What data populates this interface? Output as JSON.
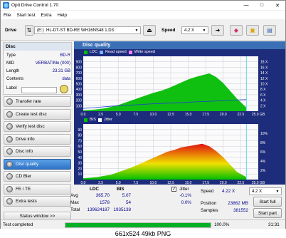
{
  "window": {
    "title": "Opti Drive Control 1.70",
    "min": "—",
    "max": "□",
    "close": "✕"
  },
  "menu": [
    "File",
    "Start test",
    "Extra",
    "Help"
  ],
  "drivebar": {
    "drive_label": "Drive",
    "drive_letter": "(E:)",
    "drive_name": "HL-DT-ST BD-RE  WH16NS48 1.D3",
    "speed_label": "Speed",
    "speed_value": "4.2 X"
  },
  "disc": {
    "header": "Disc",
    "rows": [
      {
        "k": "Type",
        "v": "BD-R"
      },
      {
        "k": "MID",
        "v": "VERBATIMe (000)"
      },
      {
        "k": "Length",
        "v": "23.31 GB"
      },
      {
        "k": "Contents",
        "v": "data"
      }
    ],
    "label_key": "Label"
  },
  "nav": [
    {
      "label": "Transfer rate",
      "active": false
    },
    {
      "label": "Create test disc",
      "active": false
    },
    {
      "label": "Verify test disc",
      "active": false
    },
    {
      "label": "Drive info",
      "active": false
    },
    {
      "label": "Disc info",
      "active": false
    },
    {
      "label": "Disc quality",
      "active": true
    },
    {
      "label": "CD Bler",
      "active": false
    },
    {
      "label": "FE / TE",
      "active": false
    },
    {
      "label": "Extra tests",
      "active": false
    }
  ],
  "status_window_label": "Status window >>",
  "quality": {
    "header": "Disc quality",
    "legend_top": [
      {
        "name": "LDC",
        "color": "#00c000"
      },
      {
        "name": "Read speed",
        "color": "#7ab0ff"
      },
      {
        "name": "Write speed",
        "color": "#ff80ff"
      }
    ],
    "legend_bottom": [
      {
        "name": "BIS",
        "color": "#00c000"
      },
      {
        "name": "Jitter",
        "color": "#ffffff"
      }
    ]
  },
  "chart_data": [
    {
      "type": "area",
      "title": "LDC",
      "x_ticks": [
        "0.0",
        "2.5",
        "5.0",
        "7.5",
        "10.0",
        "12.5",
        "15.0",
        "17.5",
        "20.0",
        "22.5",
        "25.0 GB"
      ],
      "y_left_ticks": [
        "100",
        "200",
        "300",
        "400",
        "500",
        "600",
        "700",
        "800",
        "900"
      ],
      "y_right_ticks": [
        "2 X",
        "4 X",
        "6 X",
        "8 X",
        "10 X",
        "12 X",
        "14 X",
        "16 X",
        "18 X"
      ],
      "xlim": [
        0,
        25
      ],
      "ylim": [
        0,
        900
      ],
      "series": [
        {
          "name": "LDC",
          "x": [
            0,
            1,
            2,
            3,
            4,
            5,
            6,
            7,
            8,
            9,
            10,
            11,
            12,
            13,
            14,
            15,
            16,
            17,
            18,
            19,
            20,
            21,
            22,
            23.3
          ],
          "values": [
            15,
            20,
            30,
            45,
            70,
            100,
            140,
            180,
            220,
            260,
            300,
            330,
            370,
            420,
            470,
            520,
            560,
            590,
            620,
            560,
            460,
            330,
            200,
            60
          ]
        },
        {
          "name": "Read speed",
          "x": [
            0,
            2,
            4,
            6,
            8,
            10,
            12,
            14,
            16,
            18,
            20,
            22,
            23.3
          ],
          "values": [
            1.0,
            1.4,
            1.8,
            2.1,
            2.4,
            2.7,
            2.9,
            3.1,
            3.4,
            3.6,
            3.8,
            4.1,
            4.2
          ]
        }
      ]
    },
    {
      "type": "area",
      "title": "BIS",
      "x_ticks": [
        "0.0",
        "2.5",
        "5.0",
        "7.5",
        "10.0",
        "12.5",
        "15.0",
        "17.5",
        "20.0",
        "22.5",
        "25.0 GB"
      ],
      "y_left_ticks": [
        "10",
        "20",
        "30",
        "40",
        "50",
        "60",
        "70",
        "80",
        "90"
      ],
      "y_right_ticks": [
        "2%",
        "4%",
        "6%",
        "8%",
        "10%"
      ],
      "xlim": [
        0,
        25
      ],
      "ylim": [
        0,
        90
      ],
      "series": [
        {
          "name": "BIS",
          "x": [
            0,
            1,
            2,
            3,
            4,
            5,
            6,
            7,
            8,
            9,
            10,
            11,
            12,
            13,
            14,
            15,
            16,
            17,
            18,
            19,
            20,
            21,
            22,
            23.3
          ],
          "values": [
            2,
            3,
            4,
            6,
            8,
            12,
            16,
            20,
            25,
            30,
            35,
            40,
            45,
            48,
            52,
            54,
            56,
            58,
            54,
            46,
            36,
            24,
            12,
            4
          ]
        }
      ]
    }
  ],
  "stats": {
    "col_ldc": "LDC",
    "col_bis": "BIS",
    "jitter_label": "Jitter",
    "rows": [
      {
        "k": "Avg",
        "ldc": "365.70",
        "bis": "5.07",
        "jit": "-0.1%"
      },
      {
        "k": "Max",
        "ldc": "1578",
        "bis": "54",
        "jit": "0.0%"
      },
      {
        "k": "Total",
        "ldc": "139624187",
        "bis": "1935138",
        "jit": ""
      }
    ],
    "speed_label": "Speed",
    "speed_value": "4.22 X",
    "speed_combo": "4.2 X",
    "position_label": "Position",
    "position_value": "23862 MB",
    "samples_label": "Samples",
    "samples_value": "381552",
    "start_full": "Start full",
    "start_part": "Start part"
  },
  "statusbar": {
    "text": "Test completed",
    "percent": "100.0%",
    "progress": 1.0,
    "time": "31:31"
  },
  "caption": "661x524  49kb  PNG"
}
